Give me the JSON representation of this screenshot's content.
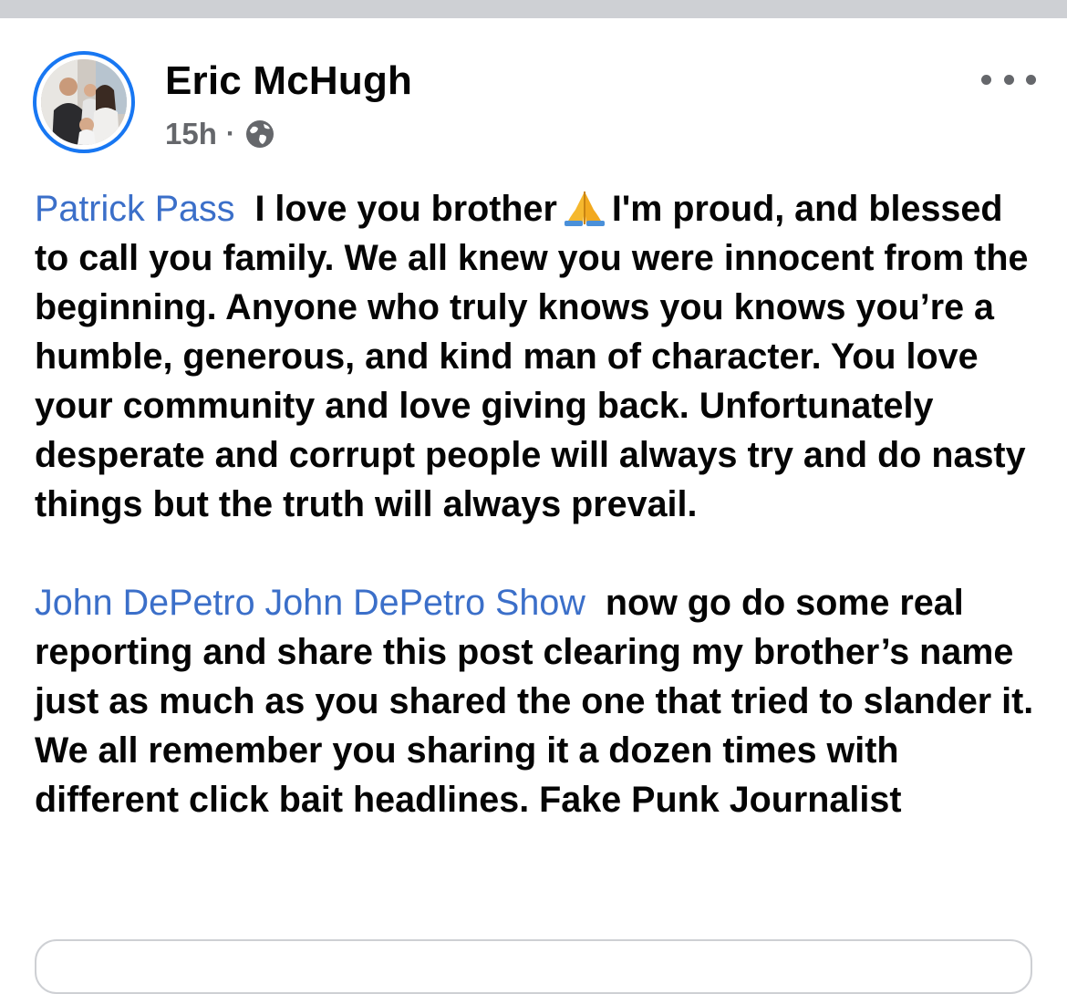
{
  "post": {
    "author": "Eric McHugh",
    "timestamp": "15h",
    "separator": "·",
    "audience_icon": "globe-icon",
    "more_icon": "more-horizontal-icon",
    "paragraph1": {
      "mention": "Patrick Pass",
      "text_before_emoji": "I love you brother",
      "emoji": "folded-hands-emoji",
      "text_after_emoji": "I'm proud, and blessed to call you family. We all knew you were innocent from the beginning. Anyone who truly knows you knows you’re a humble, generous, and kind man of character. You love your community and love giving back. Unfortunately desperate and corrupt people will always try and do nasty things but the truth will always prevail."
    },
    "paragraph2": {
      "mentions": [
        "John DePetro",
        "John DePetro Show"
      ],
      "text": "now go do some real reporting and share this post clearing my brother’s name just as much as you shared the one that tried to slander it. We all remember you sharing it a dozen times with different click bait headlines. Fake Punk Journalist"
    }
  },
  "colors": {
    "mention": "#3b6fc9",
    "text": "#050505",
    "secondary": "#65676b",
    "avatar_ring": "#1877f2",
    "divider": "#ced0d4"
  }
}
